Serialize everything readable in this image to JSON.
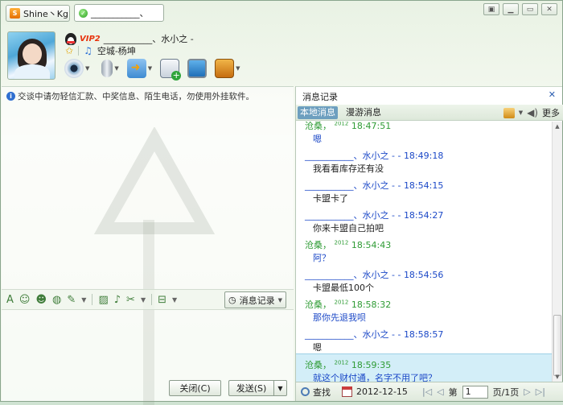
{
  "titlebar": {
    "account_tab": "Shine丶Kg",
    "chat_tab": "___________、",
    "window_buttons": [
      "skin-icon",
      "minimize-icon",
      "maximize-icon",
      "close-icon"
    ]
  },
  "contact": {
    "vip_label": "VIP2",
    "nickname": "___________、水小之 -",
    "signature": "空城-杨坤"
  },
  "left": {
    "warning": "交谈中请勿轻信汇款、中奖信息、陌生电话，勿使用外挂软件。",
    "history_button": "消息记录",
    "close_button": "关闭(C)",
    "send_button": "发送(S)"
  },
  "history": {
    "title": "消息记录",
    "tab_local": "本地消息",
    "tab_roam": "漫游消息",
    "more": "更多",
    "messages": [
      {
        "sender": "沧桑，",
        "year": "2012",
        "time": "18:47:51",
        "text": "嗯",
        "self": false,
        "blue_text": true,
        "selected": false
      },
      {
        "sender": "___________、水小之 - ",
        "year": "",
        "time": "18:49:18",
        "text": "我看看库存还有没",
        "self": true,
        "blue_text": false,
        "selected": false
      },
      {
        "sender": "___________、水小之 - ",
        "year": "",
        "time": "18:54:15",
        "text": "卡盟卡了",
        "self": true,
        "blue_text": false,
        "selected": false
      },
      {
        "sender": "___________、水小之 - ",
        "year": "",
        "time": "18:54:27",
        "text": "你来卡盟自己拍吧",
        "self": true,
        "blue_text": false,
        "selected": false
      },
      {
        "sender": "沧桑，",
        "year": "2012",
        "time": "18:54:43",
        "text": "阿？",
        "self": false,
        "blue_text": true,
        "selected": false
      },
      {
        "sender": "___________、水小之 - ",
        "year": "",
        "time": "18:54:56",
        "text": "卡盟最低100个",
        "self": true,
        "blue_text": false,
        "selected": false
      },
      {
        "sender": "沧桑，",
        "year": "2012",
        "time": "18:58:32",
        "text": "那你先退我呗",
        "self": false,
        "blue_text": true,
        "selected": false
      },
      {
        "sender": "___________、水小之 - ",
        "year": "",
        "time": "18:58:57",
        "text": "嗯",
        "self": true,
        "blue_text": false,
        "selected": false
      },
      {
        "sender": "沧桑，",
        "year": "2012",
        "time": "18:59:35",
        "text": "就这个财付通，名字不用了吧？",
        "self": false,
        "blue_text": true,
        "selected": true
      }
    ],
    "footer": {
      "search": "查找",
      "date": "2012-12-15",
      "page_label": "第",
      "page_value": "1",
      "page_total": "页/1页"
    }
  }
}
